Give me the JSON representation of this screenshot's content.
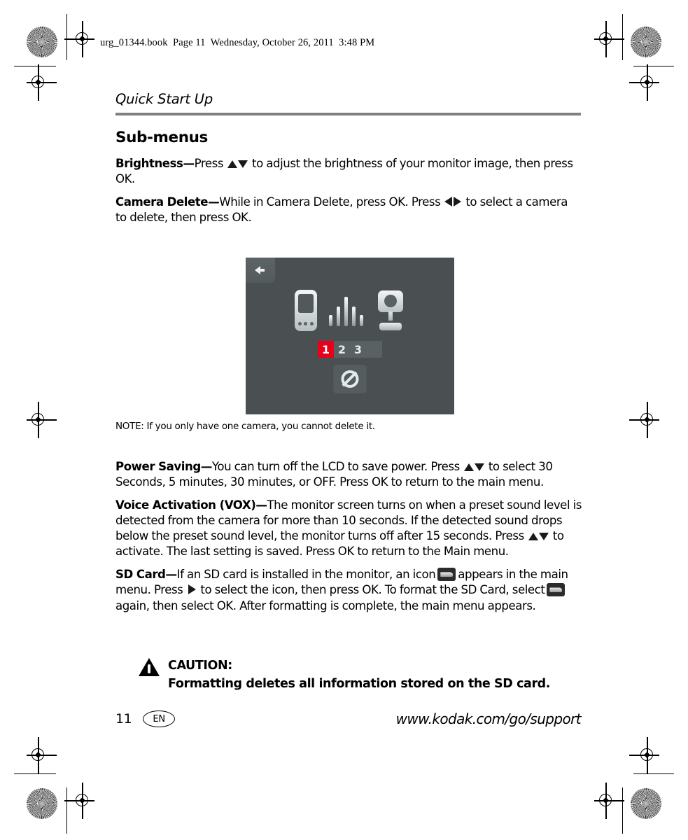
{
  "slug_line": "urg_01344.book  Page 11  Wednesday, October 26, 2011  3:48 PM",
  "running_head": "Quick Start Up",
  "section_title": "Sub-menus",
  "entries": {
    "brightness": {
      "term": "Brightness—",
      "text_before": "Press",
      "text_after": "to adjust the brightness of your monitor image, then press OK."
    },
    "camera_delete": {
      "term": "Camera Delete—",
      "text_before": "While in Camera Delete, press OK. Press",
      "text_after": "to select a camera to delete, then press OK."
    },
    "power_saving": {
      "term": "Power Saving—",
      "text_before": "You can turn off the LCD to save power. Press",
      "text_after": "to select 30 Seconds, 5 minutes, 30 minutes, or OFF. Press OK to return to the main menu."
    },
    "voice_activation": {
      "term": "Voice Activation (VOX)—",
      "text_before": "The monitor screen turns on when a preset sound level is detected from the camera for more than 10 seconds. If the detected sound drops below the preset sound level, the monitor turns off after 15 seconds. Press",
      "text_after": "to activate. The last setting is saved. Press OK to return to the Main menu."
    },
    "sd_card": {
      "term": "SD Card—",
      "part1": "If an SD card is installed in the monitor, an icon",
      "part2": "appears in the main menu. Press",
      "part3": "to select the icon, then press OK. To format the SD Card, select",
      "part4": "again, then select OK. After formatting is complete, the main menu appears."
    }
  },
  "note": "NOTE:  If you only have one camera, you cannot delete it.",
  "device_screenshot": {
    "background_color": "#4a4f51",
    "back_button_label": "back-arrow",
    "icons": [
      "handheld-monitor",
      "signal-strength",
      "camera"
    ],
    "camera_selector": {
      "slots": [
        "1",
        "2",
        "3",
        ""
      ],
      "active_index": 0,
      "active_color": "#e8001b"
    },
    "action_button": "no-delete-prohibited"
  },
  "caution": {
    "label": "CAUTION:",
    "message": "Formatting deletes all information stored on the SD card."
  },
  "footer": {
    "page_number": "11",
    "language": "EN",
    "support_url": "www.kodak.com/go/support"
  }
}
